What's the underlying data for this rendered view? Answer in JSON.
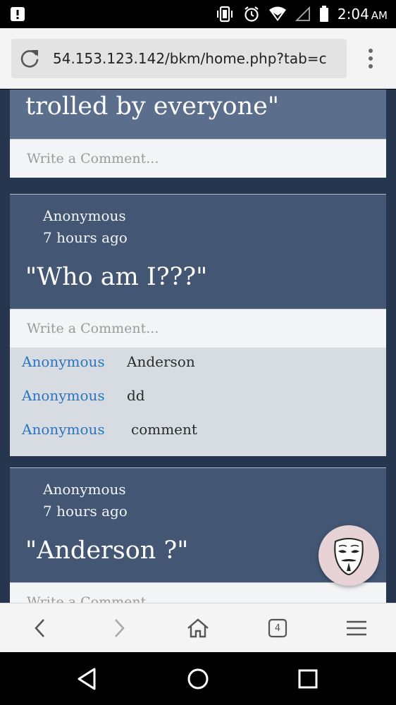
{
  "status_bar": {
    "time": "2:04",
    "ampm": "AM",
    "icons": [
      "notification-icon",
      "vibrate-icon",
      "alarm-icon",
      "wifi-icon",
      "signal-icon",
      "battery-icon"
    ]
  },
  "browser": {
    "url": "54.153.123.142/bkm/home.php?tab=c",
    "tab_count": "4",
    "icons": [
      "reload-icon",
      "more-vert-icon",
      "back-icon",
      "forward-icon",
      "home-icon",
      "tabs-icon",
      "menu-icon"
    ]
  },
  "posts": [
    {
      "quote": "trolled by everyone\"",
      "comment_placeholder": "Write a Comment..."
    },
    {
      "author": "Anonymous",
      "time": "7 hours ago",
      "quote": "\"Who am I???\"",
      "comment_placeholder": "Write a Comment...",
      "replies": [
        {
          "author": "Anonymous",
          "text": "Anderson"
        },
        {
          "author": "Anonymous",
          "text": "dd"
        },
        {
          "author": "Anonymous",
          "text": "comment"
        }
      ]
    },
    {
      "author": "Anonymous",
      "time": "7 hours ago",
      "quote": "\"Anderson ?\"",
      "comment_placeholder": "Write a Comment..."
    }
  ],
  "colors": {
    "page_bg": "#26364e",
    "card_bg": "#435673",
    "reply_author": "#2d74be",
    "replies_bg": "#d7dce3"
  }
}
